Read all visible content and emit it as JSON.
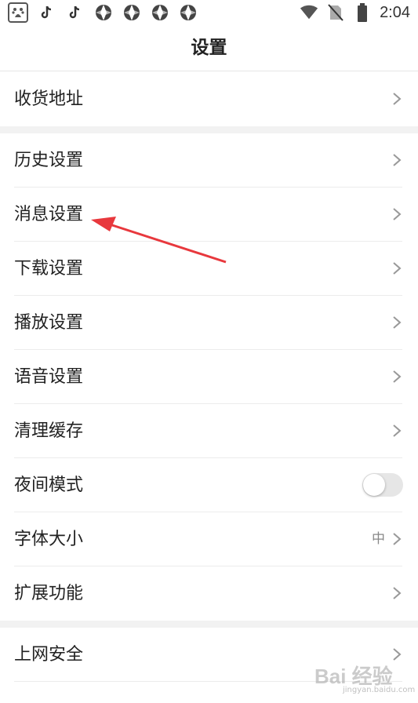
{
  "status_bar": {
    "time": "2:04",
    "left_icons": [
      "baidu-app-icon",
      "tiktok-icon",
      "tiktok-icon",
      "aperture-icon",
      "aperture-icon",
      "aperture-icon",
      "aperture-icon"
    ],
    "right_icons": [
      "wifi-icon",
      "no-sim-icon",
      "battery-icon"
    ]
  },
  "header": {
    "title": "设置"
  },
  "groups": [
    {
      "items": [
        {
          "label": "收货地址",
          "type": "chevron"
        }
      ]
    },
    {
      "items": [
        {
          "label": "历史设置",
          "type": "chevron"
        },
        {
          "label": "消息设置",
          "type": "chevron"
        },
        {
          "label": "下载设置",
          "type": "chevron"
        },
        {
          "label": "播放设置",
          "type": "chevron"
        },
        {
          "label": "语音设置",
          "type": "chevron"
        },
        {
          "label": "清理缓存",
          "type": "chevron"
        },
        {
          "label": "夜间模式",
          "type": "toggle",
          "enabled": false
        },
        {
          "label": "字体大小",
          "type": "chevron",
          "value": "中"
        },
        {
          "label": "扩展功能",
          "type": "chevron"
        }
      ]
    },
    {
      "items": [
        {
          "label": "上网安全",
          "type": "chevron"
        }
      ]
    }
  ],
  "annotation": {
    "type": "red-arrow",
    "target": "消息设置",
    "color": "#e8383d"
  },
  "watermark": {
    "text": "Bai 经验",
    "sub": "jingyan.baidu.com"
  },
  "colors": {
    "background": "#ffffff",
    "separator": "#f2f2f2",
    "text": "#222222",
    "secondary_text": "#888888",
    "toggle_off": "#e6e6e6"
  }
}
